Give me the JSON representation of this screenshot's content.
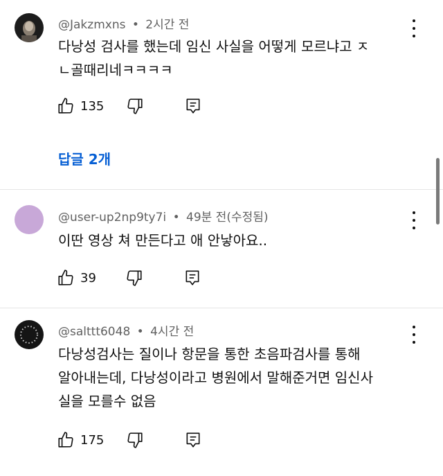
{
  "comments": [
    {
      "author": "@Jakzmxns",
      "time": "2시간 전",
      "text_lines": [
        "다낭성 검사를 했는데 임신 사실을 어떻게 모르냐고 ㅈ",
        "ㄴ골때리네ㅋㅋㅋㅋ"
      ],
      "likes": "135",
      "replies_label": "답글 2개",
      "avatar_icon": "dark-photo-avatar"
    },
    {
      "author": "@user-up2np9ty7i",
      "time": "49분 전(수정됨)",
      "text_lines": [
        "이딴 영상 쳐 만든다고 애 안낳아요.."
      ],
      "likes": "39",
      "avatar_color": "#c8a8d8"
    },
    {
      "author": "@salttt6048",
      "time": "4시간 전",
      "text_lines": [
        "다낭성검사는 질이나 항문을 통한 초음파검사를 통해",
        "알아내는데, 다낭성이라고 병원에서 말해준거면 임신사",
        "실을 모를수 없음"
      ],
      "likes": "175",
      "avatar_icon": "dotted-ring-avatar"
    }
  ],
  "separator": "•",
  "icons": {
    "like": "thumbs-up-icon",
    "dislike": "thumbs-down-icon",
    "reply": "reply-icon",
    "more": "more-vert-icon"
  },
  "colors": {
    "link": "#065fd4",
    "meta": "#606060",
    "text": "#0f0f0f"
  }
}
